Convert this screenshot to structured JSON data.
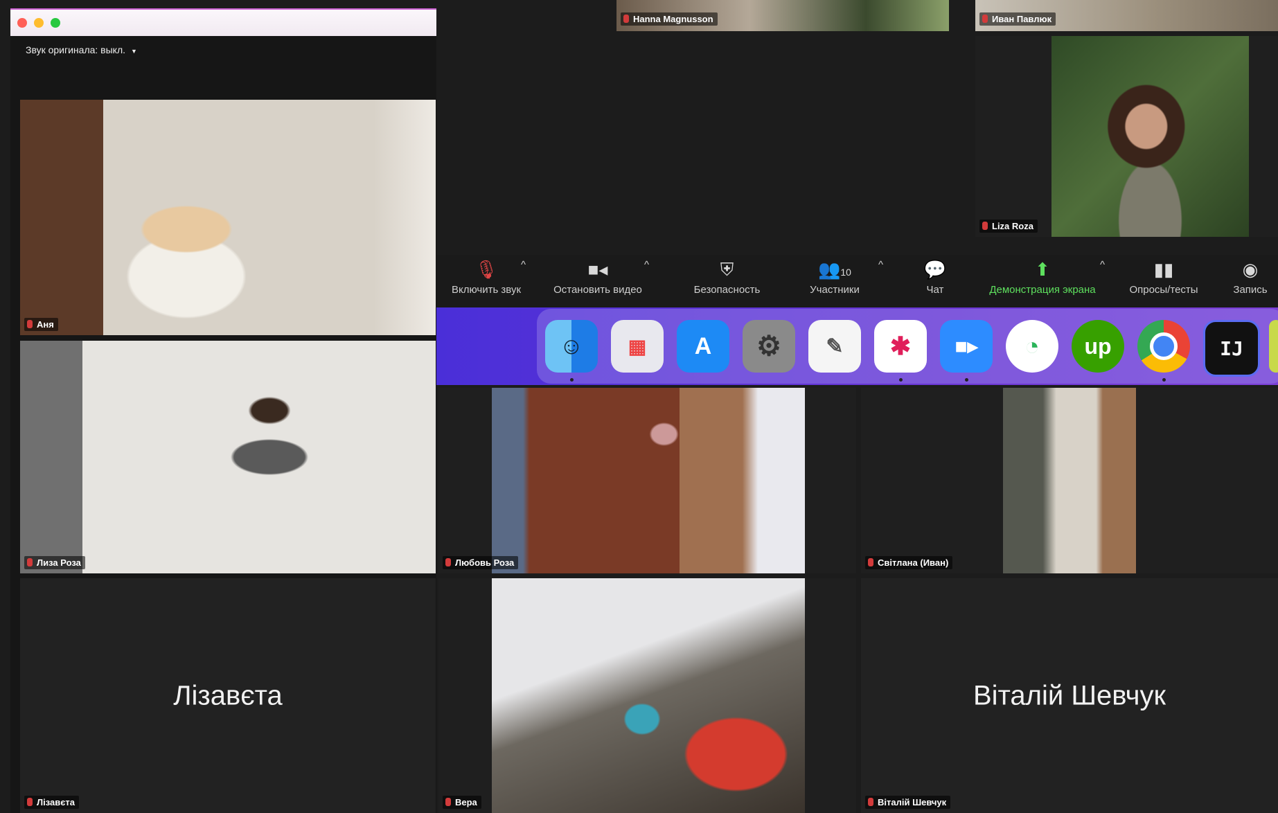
{
  "left_window": {
    "original_audio": "Звук оригинала: выкл."
  },
  "toolbar": {
    "unmute": "Включить звук",
    "stop_video": "Остановить видео",
    "security": "Безопасность",
    "participants": "Участники",
    "participants_count": "10",
    "chat": "Чат",
    "share_screen": "Демонстрация экрана",
    "polls": "Опросы/тесты",
    "record": "Запись"
  },
  "participants": {
    "hanna": "Hanna Magnusson",
    "ivan_pavliuk": "Иван Павлюк",
    "liza_roza_top": "Liza Roza",
    "anya": "Аня",
    "liza_roza": "Лиза Роза",
    "lyubov_roza": "Любовь Роза",
    "svitlana": "Світлана (Иван)",
    "lizaveta": "Лізавєта",
    "vira": "Вера",
    "vitaliy": "Віталій Шевчук"
  },
  "big_names": {
    "lizaveta": "Лізавєта",
    "vitaliy": "Віталій Шевчук"
  },
  "dock": {
    "apps": [
      "finder",
      "launchpad",
      "app-store",
      "system-preferences",
      "textedit",
      "slack",
      "zoom",
      "time",
      "upwork",
      "chrome",
      "intellij"
    ],
    "upwork_label": "up",
    "intellij_label": "IJ"
  },
  "colors": {
    "share_green": "#5ee05e",
    "dock_purple": "#6a36d4",
    "mic_red": "#d23b3b"
  }
}
